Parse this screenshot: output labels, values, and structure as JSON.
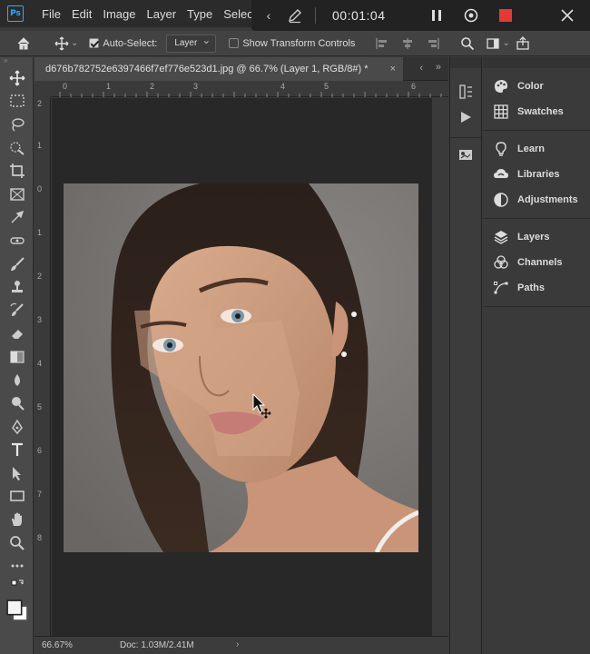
{
  "app": {
    "logo": "Ps"
  },
  "menu": {
    "items": [
      "File",
      "Edit",
      "Image",
      "Layer",
      "Type",
      "Select"
    ]
  },
  "recorder": {
    "timer": "00:01:04"
  },
  "options_bar": {
    "auto_select_label": "Auto-Select:",
    "auto_select_checked": true,
    "layer_dropdown_value": "Layer",
    "show_transform_label": "Show Transform Controls",
    "show_transform_checked": false
  },
  "document": {
    "tab_title": "d676b782752e6397466f7ef776e523d1.jpg @ 66.7% (Layer 1, RGB/8#) *",
    "close_glyph": "×",
    "ruler_h_labels": [
      "0",
      "1",
      "2",
      "3",
      "4",
      "5",
      "6"
    ],
    "ruler_v_labels": [
      "2",
      "1",
      "0",
      "1",
      "2",
      "3",
      "4",
      "5",
      "6",
      "7",
      "8"
    ],
    "zoom": "66.67%",
    "doc_size": "Doc: 1.03M/2.41M"
  },
  "panels": {
    "groups": [
      [
        {
          "label": "Color",
          "icon": "color-icon"
        },
        {
          "label": "Swatches",
          "icon": "swatches-icon"
        }
      ],
      [
        {
          "label": "Learn",
          "icon": "learn-icon"
        },
        {
          "label": "Libraries",
          "icon": "libraries-icon"
        },
        {
          "label": "Adjustments",
          "icon": "adjustments-icon"
        }
      ],
      [
        {
          "label": "Layers",
          "icon": "layers-icon"
        },
        {
          "label": "Channels",
          "icon": "channels-icon"
        },
        {
          "label": "Paths",
          "icon": "paths-icon"
        }
      ]
    ]
  },
  "colors": {
    "accent": "#31a8ff",
    "record_stop": "#e53935",
    "ui_dark": "#2b2b2b",
    "ui_panel": "#3a3a3a"
  }
}
